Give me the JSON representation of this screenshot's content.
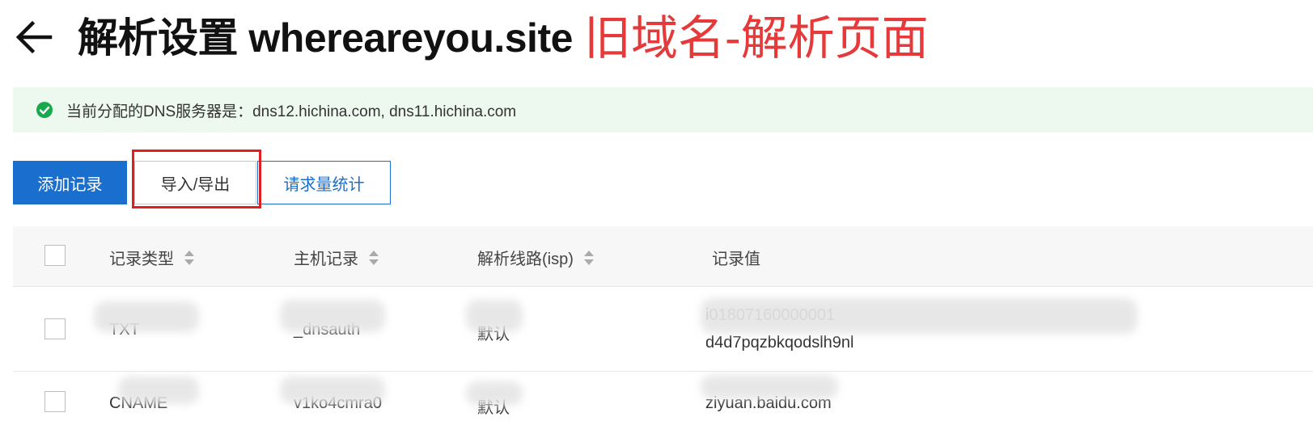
{
  "header": {
    "title": "解析设置 whereareyou.site",
    "annotation": "旧域名-解析页面"
  },
  "dns_banner": {
    "text": "当前分配的DNS服务器是：dns12.hichina.com, dns11.hichina.com"
  },
  "toolbar": {
    "add_label": "添加记录",
    "import_export_label": "导入/导出",
    "stats_label": "请求量统计"
  },
  "table": {
    "columns": [
      "记录类型",
      "主机记录",
      "解析线路(isp)",
      "记录值"
    ],
    "rows": [
      {
        "type": "TXT",
        "host": "_dnsauth",
        "line": "默认",
        "value_line1": "i01807160000001",
        "value_line2": "d4d7pqzbkqodslh9nl"
      },
      {
        "type": "CNAME",
        "host": "v1ko4cmra0",
        "line": "默认",
        "value_line1": "ziyuan.baidu.com",
        "value_line2": ""
      }
    ]
  },
  "colors": {
    "primary": "#1a6fce",
    "annotation": "#e63a3a",
    "highlight": "#e02020",
    "success": "#1aa84f",
    "banner_bg": "#edf8ef"
  }
}
